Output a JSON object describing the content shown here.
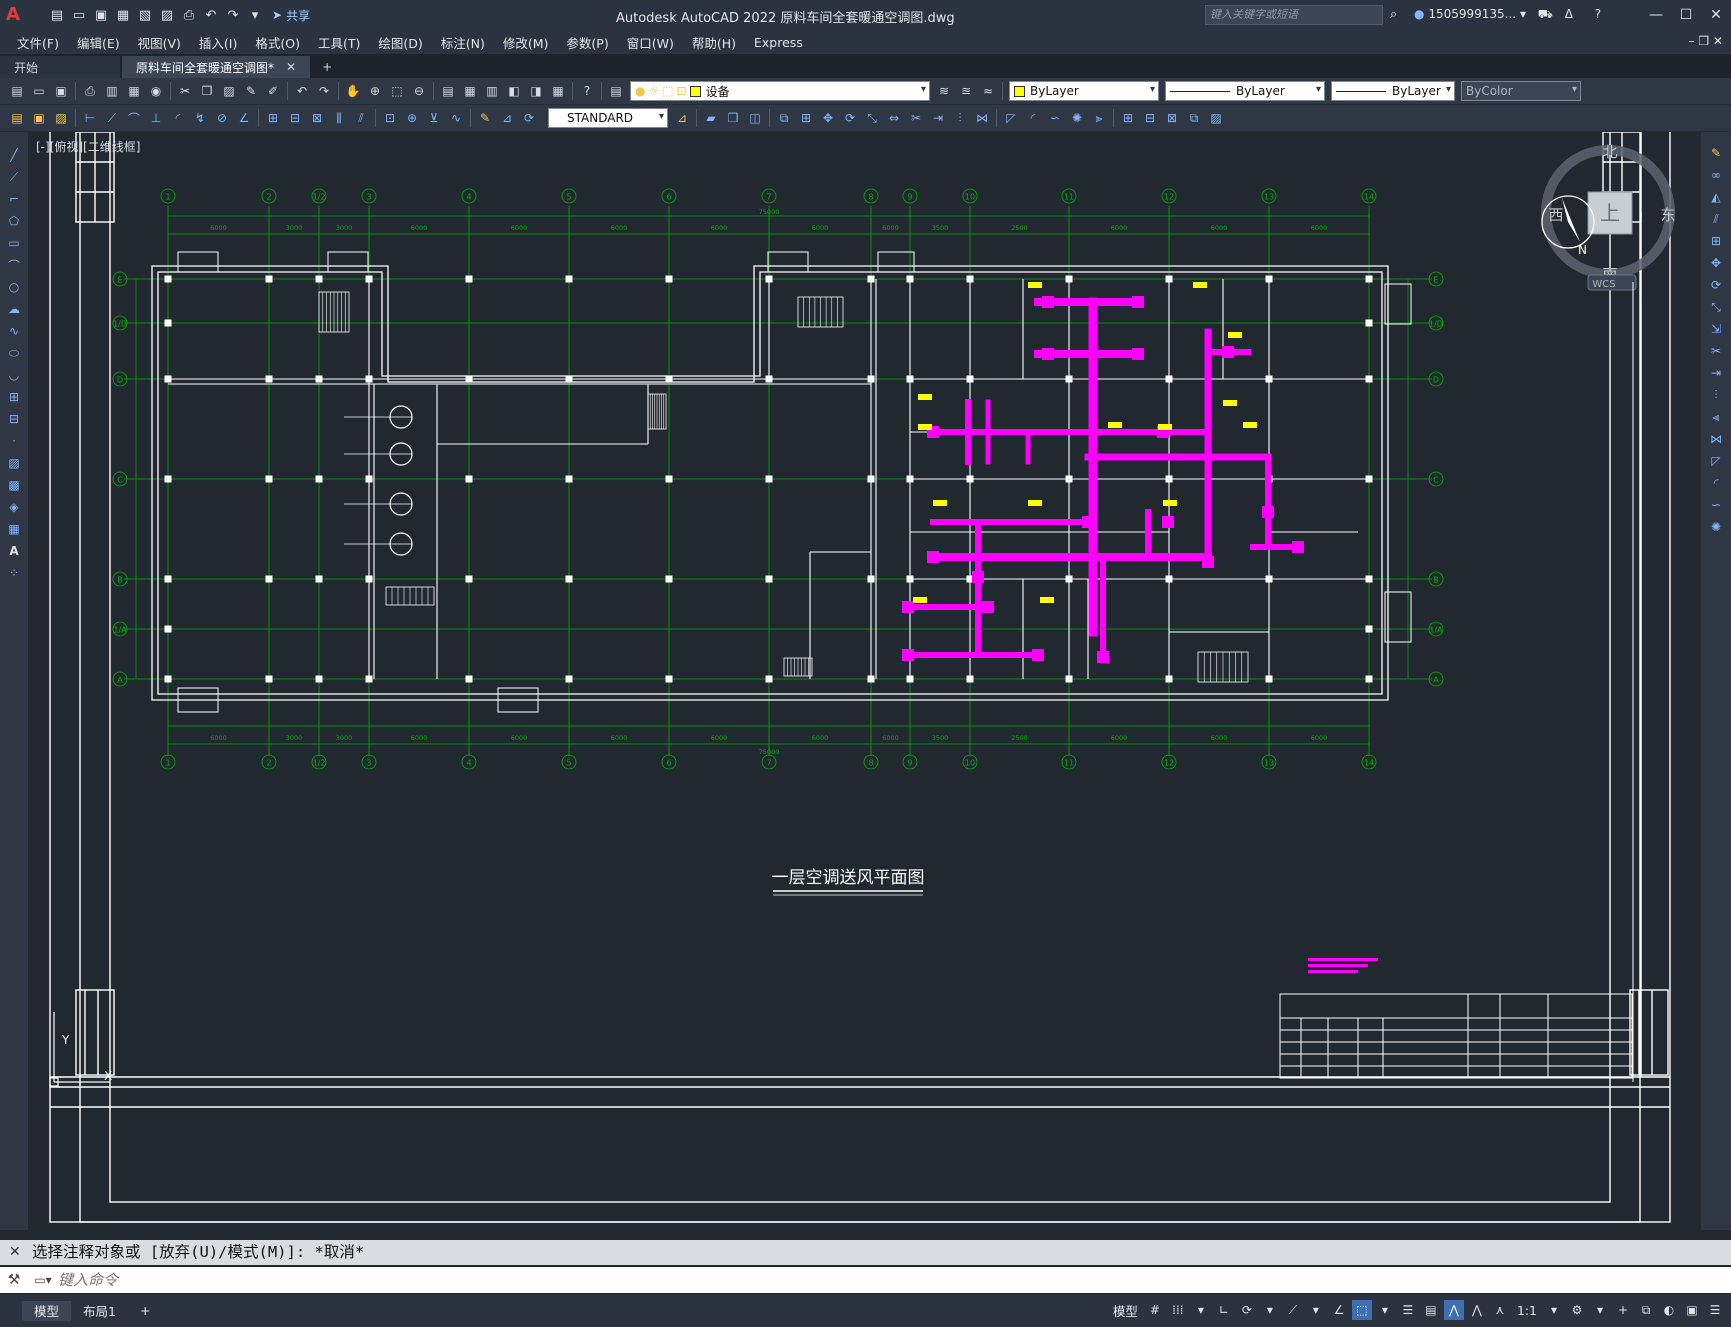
{
  "app": {
    "title": "Autodesk AutoCAD 2022    原料车间全套暖通空调图.dwg",
    "logo": "A",
    "share_label": "共享",
    "search_placeholder": "键入关键字或短语",
    "user_name": "1505999135..."
  },
  "menu": [
    "文件(F)",
    "编辑(E)",
    "视图(V)",
    "插入(I)",
    "格式(O)",
    "工具(T)",
    "绘图(D)",
    "标注(N)",
    "修改(M)",
    "参数(P)",
    "窗口(W)",
    "帮助(H)",
    "Express"
  ],
  "file_tabs": [
    {
      "label": "开始",
      "active": false
    },
    {
      "label": "原料车间全套暖通空调图*",
      "active": true
    }
  ],
  "toolbar": {
    "layer_name": "设备",
    "color": "ByLayer",
    "linetype": "ByLayer",
    "lineweight": "ByLayer",
    "plotstyle": "ByColor",
    "text_style": "STANDARD"
  },
  "viewport": {
    "label": "[-][俯视][二维线框]",
    "drawing_title": "一层空调送风平面图",
    "viewcube": {
      "top": "上",
      "north": "北",
      "south": "南",
      "east": "东",
      "west": "西",
      "compass_n": "N",
      "wcs": "WCS"
    }
  },
  "grid": {
    "col_labels": [
      "1",
      "2",
      "1/2",
      "3",
      "4",
      "5",
      "6",
      "7",
      "8",
      "9",
      "10",
      "11",
      "12",
      "13",
      "14"
    ],
    "row_labels": [
      "A",
      "1/A",
      "B",
      "C",
      "D",
      "1/D",
      "E"
    ],
    "top_dims": [
      "6000",
      "3000",
      "3000",
      "6000",
      "6000",
      "6000",
      "6000",
      "6000",
      "6000",
      "3500",
      "2500",
      "6000",
      "6000",
      "6000",
      "6000"
    ],
    "total_dim": "75000"
  },
  "ucs": {
    "y": "Y",
    "x": "X"
  },
  "command": {
    "history": "选择注释对象或 [放弃(U)/模式(M)]: *取消*",
    "placeholder": "键入命令"
  },
  "layout_tabs": [
    {
      "label": "模型",
      "active": true
    },
    {
      "label": "布局1",
      "active": false
    }
  ],
  "status": {
    "model_label": "模型",
    "scale": "1:1"
  },
  "colors": {
    "grid": "#00b000",
    "walls": "#ffffff",
    "duct": "#ff00ff",
    "tag": "#ffff00",
    "canvas": "#212830"
  }
}
